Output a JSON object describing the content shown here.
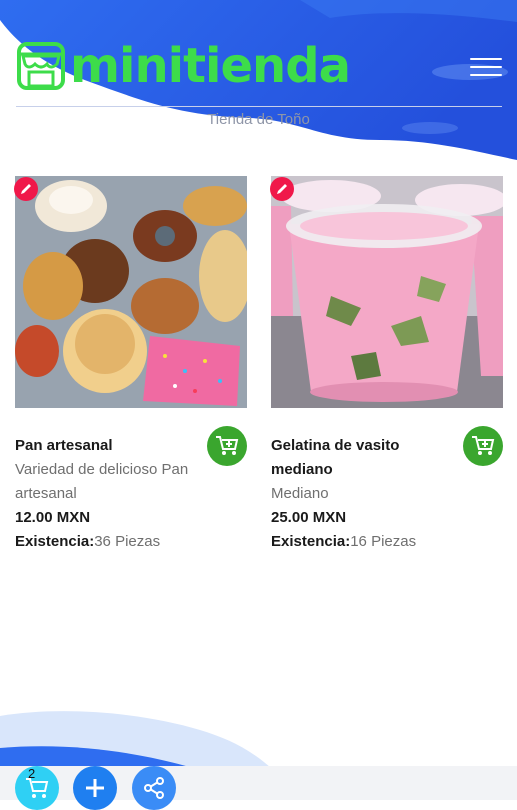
{
  "header": {
    "brand": "minitienda",
    "store_name": "Tienda de Toño"
  },
  "products": [
    {
      "name": "Pan artesanal",
      "description": "Variedad de delicioso Pan artesanal",
      "price": "12.00 MXN",
      "stock_label": "Existencia:",
      "stock_value": "36 Piezas"
    },
    {
      "name": "Gelatina de vasito mediano",
      "description": "Mediano",
      "price": "25.00 MXN",
      "stock_label": "Existencia:",
      "stock_value": "16 Piezas"
    }
  ],
  "footer": {
    "cart_count": "2"
  },
  "colors": {
    "brand_green": "#3ddc4a",
    "header_blue": "#2a5fe0",
    "edit_red": "#f0184a",
    "cart_green": "#3aa62e"
  }
}
